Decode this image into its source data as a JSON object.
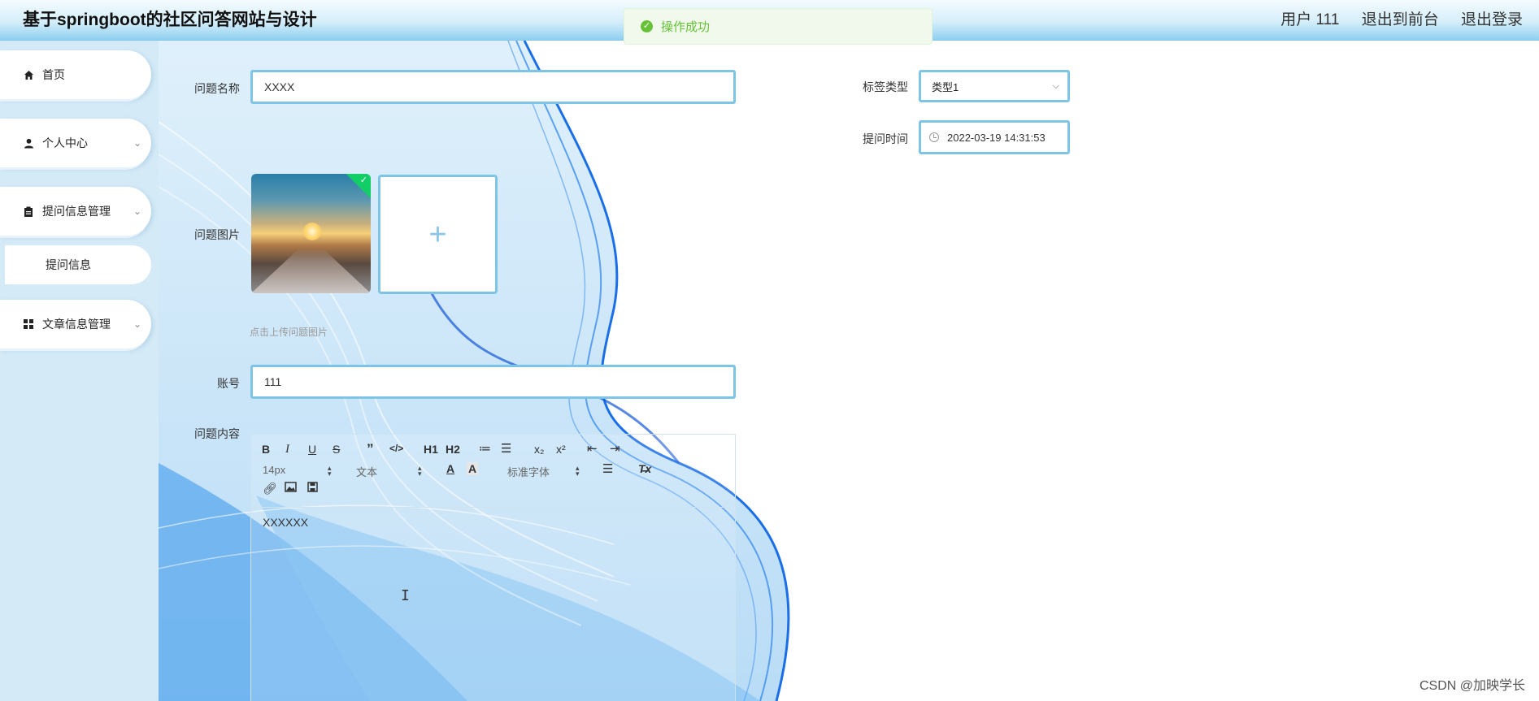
{
  "header": {
    "app_title": "基于springboot的社区问答网站与设计",
    "user_label": "用户 111",
    "to_frontend": "退出到前台",
    "logout": "退出登录"
  },
  "toast": {
    "message": "操作成功",
    "type": "success"
  },
  "sidebar": {
    "items": [
      {
        "label": "首页",
        "icon": "home-icon"
      },
      {
        "label": "个人中心",
        "icon": "user-icon",
        "has_children": true
      },
      {
        "label": "提问信息管理",
        "icon": "clipboard-icon",
        "has_children": true,
        "expanded": true
      },
      {
        "label": "文章信息管理",
        "icon": "grid-icon",
        "has_children": true
      }
    ],
    "sub_items": [
      {
        "label": "提问信息",
        "parent": "提问信息管理"
      }
    ]
  },
  "form": {
    "question_name": {
      "label": "问题名称",
      "value": "XXXX"
    },
    "tag_type": {
      "label": "标签类型",
      "value": "类型1"
    },
    "ask_time": {
      "label": "提问时间",
      "value": "2022-03-19 14:31:53"
    },
    "question_image": {
      "label": "问题图片",
      "upload_tip": "点击上传问题图片",
      "plus": "+"
    },
    "account": {
      "label": "账号",
      "value": "111"
    },
    "content": {
      "label": "问题内容",
      "value": "XXXXXX"
    }
  },
  "editor_toolbar": {
    "font_size": "14px",
    "header_picker": "文本",
    "font_family": "标准字体",
    "h1": "H1",
    "h2": "H2",
    "sub": "x₂",
    "sup": "x²"
  },
  "colors": {
    "accent_border": "#7ec4e6",
    "sidebar_bg": "#d4eaf7",
    "success": "#67c23a",
    "header_gradient_bottom": "#8fd0ef"
  },
  "watermark": "CSDN @加映学长"
}
